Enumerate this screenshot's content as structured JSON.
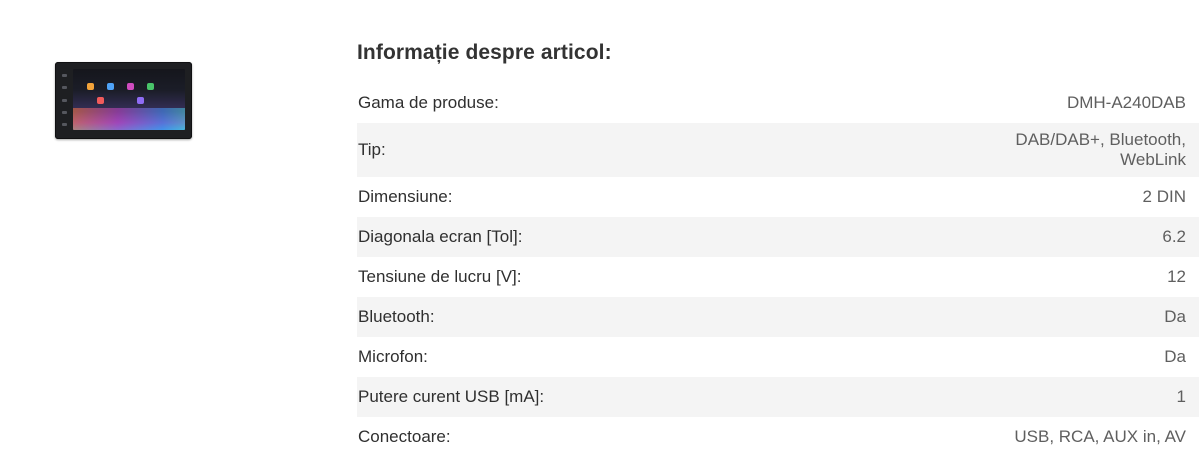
{
  "product": {
    "image_alt": "Pioneer DMH-A240DAB",
    "icon_colors": [
      "#f2a33a",
      "#4fa3f7",
      "#d04cc0",
      "#49c46a",
      "#f25b5b",
      "#8f6cf5"
    ]
  },
  "info": {
    "title": "Informație despre articol:",
    "rows": [
      {
        "label": "Gama de produse:",
        "value": "DMH-A240DAB"
      },
      {
        "label": "Tip:",
        "value": "DAB/DAB+, Bluetooth, WebLink"
      },
      {
        "label": "Dimensiune:",
        "value": "2 DIN"
      },
      {
        "label": "Diagonala ecran [Tol]:",
        "value": "6.2"
      },
      {
        "label": "Tensiune de lucru [V]:",
        "value": "12"
      },
      {
        "label": "Bluetooth:",
        "value": "Da"
      },
      {
        "label": "Microfon:",
        "value": "Da"
      },
      {
        "label": "Putere curent USB [mA]:",
        "value": "1"
      },
      {
        "label": "Conectoare:",
        "value": "USB, RCA, AUX in, AV"
      }
    ]
  }
}
